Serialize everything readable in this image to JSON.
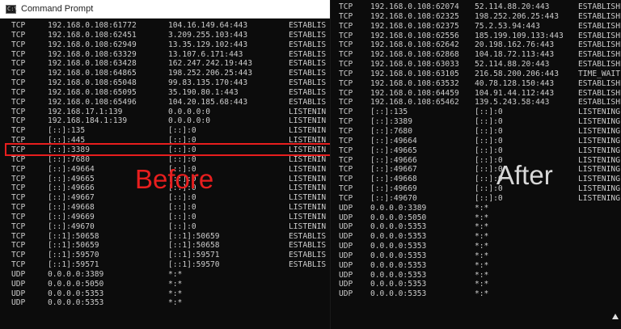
{
  "titlebar": {
    "title": "Command Prompt",
    "icon": "cmd-icon"
  },
  "labels": {
    "before": "Before",
    "after": "After"
  },
  "colors": {
    "background": "#0c0c0c",
    "text": "#cccccc",
    "highlight": "#e81e1e",
    "before_label": "#e81e1e",
    "after_label": "#d8d8d8"
  },
  "left_rows": [
    [
      "TCP",
      "192.168.0.108:61772",
      "104.16.149.64:443",
      "ESTABLIS"
    ],
    [
      "TCP",
      "192.168.0.108:62451",
      "3.209.255.103:443",
      "ESTABLIS"
    ],
    [
      "TCP",
      "192.168.0.108:62949",
      "13.35.129.102:443",
      "ESTABLIS"
    ],
    [
      "TCP",
      "192.168.0.108:63329",
      "13.107.6.171:443",
      "ESTABLIS"
    ],
    [
      "TCP",
      "192.168.0.108:63428",
      "162.247.242.19:443",
      "ESTABLIS"
    ],
    [
      "TCP",
      "192.168.0.108:64865",
      "198.252.206.25:443",
      "ESTABLIS"
    ],
    [
      "TCP",
      "192.168.0.108:65048",
      "99.83.135.170:443",
      "ESTABLIS"
    ],
    [
      "TCP",
      "192.168.0.108:65095",
      "35.190.80.1:443",
      "ESTABLIS"
    ],
    [
      "TCP",
      "192.168.0.108:65496",
      "104.20.185.68:443",
      "ESTABLIS"
    ],
    [
      "TCP",
      "192.168.17.1:139",
      "0.0.0.0:0",
      "LISTENIN"
    ],
    [
      "TCP",
      "192.168.184.1:139",
      "0.0.0.0:0",
      "LISTENIN"
    ],
    [
      "TCP",
      "[::]:135",
      "[::]:0",
      "LISTENIN"
    ],
    [
      "TCP",
      "[::]:445",
      "[::]:0",
      "LISTENIN"
    ],
    [
      "TCP",
      "[::]:3389",
      "[::]:0",
      "LISTENIN"
    ],
    [
      "TCP",
      "[::]:7680",
      "[::]:0",
      "LISTENIN"
    ],
    [
      "TCP",
      "[::]:49664",
      "[::]:0",
      "LISTENIN"
    ],
    [
      "TCP",
      "[::]:49665",
      "[::]:0",
      "LISTENIN"
    ],
    [
      "TCP",
      "[::]:49666",
      "[::]:0",
      "LISTENIN"
    ],
    [
      "TCP",
      "[::]:49667",
      "[::]:0",
      "LISTENIN"
    ],
    [
      "TCP",
      "[::]:49668",
      "[::]:0",
      "LISTENIN"
    ],
    [
      "TCP",
      "[::]:49669",
      "[::]:0",
      "LISTENIN"
    ],
    [
      "TCP",
      "[::]:49670",
      "[::]:0",
      "LISTENIN"
    ],
    [
      "TCP",
      "[::1]:50658",
      "[::1]:50659",
      "ESTABLIS"
    ],
    [
      "TCP",
      "[::1]:50659",
      "[::1]:50658",
      "ESTABLIS"
    ],
    [
      "TCP",
      "[::1]:59570",
      "[::1]:59571",
      "ESTABLIS"
    ],
    [
      "TCP",
      "[::1]:59571",
      "[::1]:59570",
      "ESTABLIS"
    ],
    [
      "UDP",
      "0.0.0.0:3389",
      "*:*",
      ""
    ],
    [
      "UDP",
      "0.0.0.0:5050",
      "*:*",
      ""
    ],
    [
      "UDP",
      "0.0.0.0:5353",
      "*:*",
      ""
    ],
    [
      "UDP",
      "0.0.0.0:5353",
      "*:*",
      ""
    ]
  ],
  "right_rows": [
    [
      "TCP",
      "192.168.0.108:62074",
      "52.114.88.20:443",
      "ESTABLISHE"
    ],
    [
      "TCP",
      "192.168.0.108:62325",
      "198.252.206.25:443",
      "ESTABLISHE"
    ],
    [
      "TCP",
      "192.168.0.108:62375",
      "75.2.53.94:443",
      "ESTABLISHE"
    ],
    [
      "TCP",
      "192.168.0.108:62556",
      "185.199.109.133:443",
      "ESTABLISHE"
    ],
    [
      "TCP",
      "192.168.0.108:62642",
      "20.198.162.76:443",
      "ESTABLISHE"
    ],
    [
      "TCP",
      "192.168.0.108:62868",
      "104.18.72.113:443",
      "ESTABLISHE"
    ],
    [
      "TCP",
      "192.168.0.108:63033",
      "52.114.88.20:443",
      "ESTABLISHE"
    ],
    [
      "TCP",
      "192.168.0.108:63105",
      "216.58.200.206:443",
      "TIME_WAIT"
    ],
    [
      "TCP",
      "192.168.0.108:63532",
      "40.78.128.150:443",
      "ESTABLISHE"
    ],
    [
      "TCP",
      "192.168.0.108:64459",
      "104.91.44.112:443",
      "ESTABLISHE"
    ],
    [
      "TCP",
      "192.168.0.108:65462",
      "139.5.243.58:443",
      "ESTABLISHE"
    ],
    [
      "TCP",
      "[::]:135",
      "[::]:0",
      "LISTENING"
    ],
    [
      "TCP",
      "[::]:3389",
      "[::]:0",
      "LISTENING"
    ],
    [
      "TCP",
      "[::]:7680",
      "[::]:0",
      "LISTENING"
    ],
    [
      "TCP",
      "[::]:49664",
      "[::]:0",
      "LISTENING"
    ],
    [
      "TCP",
      "[::]:49665",
      "[::]:0",
      "LISTENING"
    ],
    [
      "TCP",
      "[::]:49666",
      "[::]:0",
      "LISTENING"
    ],
    [
      "TCP",
      "[::]:49667",
      "[::]:0",
      "LISTENING"
    ],
    [
      "TCP",
      "[::]:49668",
      "[::]:0",
      "LISTENING"
    ],
    [
      "TCP",
      "[::]:49669",
      "[::]:0",
      "LISTENING"
    ],
    [
      "TCP",
      "[::]:49670",
      "[::]:0",
      "LISTENING"
    ],
    [
      "UDP",
      "0.0.0.0:3389",
      "*:*",
      ""
    ],
    [
      "UDP",
      "0.0.0.0:5050",
      "*:*",
      ""
    ],
    [
      "UDP",
      "0.0.0.0:5353",
      "*:*",
      ""
    ],
    [
      "UDP",
      "0.0.0.0:5353",
      "*:*",
      ""
    ],
    [
      "UDP",
      "0.0.0.0:5353",
      "*:*",
      ""
    ],
    [
      "UDP",
      "0.0.0.0:5353",
      "*:*",
      ""
    ],
    [
      "UDP",
      "0.0.0.0:5353",
      "*:*",
      ""
    ],
    [
      "UDP",
      "0.0.0.0:5353",
      "*:*",
      ""
    ],
    [
      "UDP",
      "0.0.0.0:5353",
      "*:*",
      ""
    ],
    [
      "UDP",
      "0.0.0.0:5353",
      "*:*",
      ""
    ]
  ]
}
